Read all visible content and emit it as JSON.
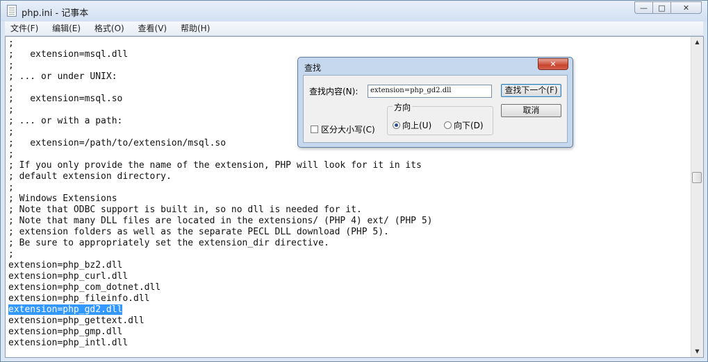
{
  "window": {
    "title": "php.ini - 记事本",
    "minimize_glyph": "—",
    "maximize_glyph": "□",
    "close_glyph": "✕"
  },
  "menu": [
    "文件(F)",
    "编辑(E)",
    "格式(O)",
    "查看(V)",
    "帮助(H)"
  ],
  "editor": {
    "lines": [
      ";",
      ";   extension=msql.dll",
      ";",
      "; ... or under UNIX:",
      ";",
      ";   extension=msql.so",
      ";",
      "; ... or with a path:",
      ";",
      ";   extension=/path/to/extension/msql.so",
      ";",
      "; If you only provide the name of the extension, PHP will look for it in its",
      "; default extension directory.",
      ";",
      "; Windows Extensions",
      "; Note that ODBC support is built in, so no dll is needed for it.",
      "; Note that many DLL files are located in the extensions/ (PHP 4) ext/ (PHP 5)",
      "; extension folders as well as the separate PECL DLL download (PHP 5).",
      "; Be sure to appropriately set the extension_dir directive.",
      ";",
      "extension=php_bz2.dll",
      "extension=php_curl.dll",
      "extension=php_com_dotnet.dll",
      "extension=php_fileinfo.dll",
      "extension=php_gd2.dll",
      "extension=php_gettext.dll",
      "extension=php_gmp.dll",
      "extension=php_intl.dll"
    ],
    "selected_line_index": 24
  },
  "scrollbar": {
    "up_glyph": "▲",
    "down_glyph": "▼"
  },
  "find_dialog": {
    "title": "查找",
    "close_glyph": "✕",
    "find_label": "查找内容(N):",
    "find_value": "extension=php_gd2.dll",
    "find_next_label": "查找下一个(F)",
    "cancel_label": "取消",
    "match_case_label": "区分大小写(C)",
    "match_case_checked": false,
    "direction_label": "方向",
    "up_label": "向上(U)",
    "down_label": "向下(D)",
    "direction_selected": "up"
  }
}
